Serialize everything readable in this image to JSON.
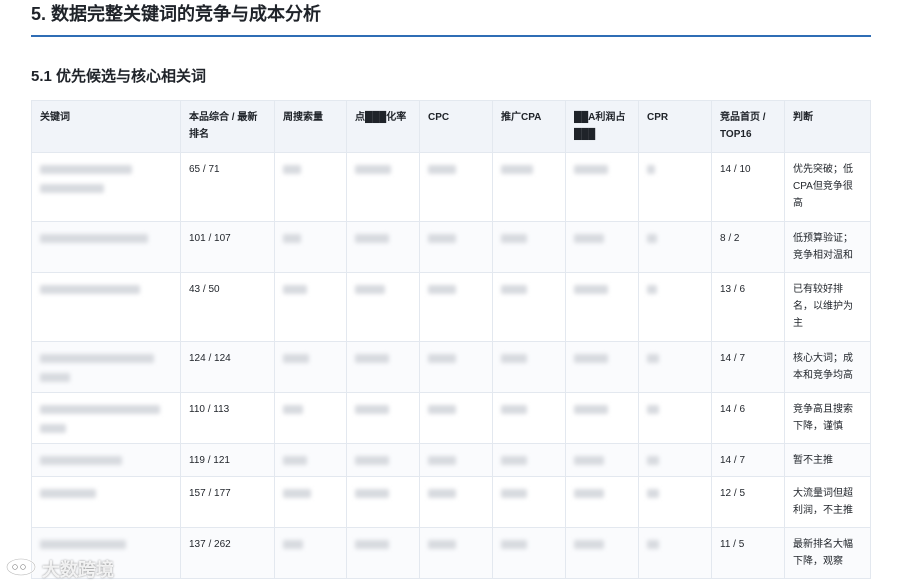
{
  "heading": "5. 数据完整关键词的竞争与成本分析",
  "subheading": "5.1 优先候选与核心相关词",
  "table": {
    "headers": [
      "关键词",
      "本品综合 / 最新排名",
      "周搜索量",
      "点███化率",
      "CPC",
      "推广CPA",
      "██A利润占███",
      "CPR",
      "竞品首页 / TOP16",
      "判断"
    ],
    "rows": [
      {
        "rank": "65 / 71",
        "top": "14 / 10",
        "judgement": "优先突破；低CPA但竞争很高"
      },
      {
        "rank": "101 / 107",
        "top": "8 / 2",
        "judgement": "低预算验证；竞争相对温和"
      },
      {
        "rank": "43 / 50",
        "top": "13 / 6",
        "judgement": "已有较好排名，以维护为主"
      },
      {
        "rank": "124 / 124",
        "top": "14 / 7",
        "judgement": "核心大词；成本和竞争均高"
      },
      {
        "rank": "110 / 113",
        "top": "14 / 6",
        "judgement": "竞争高且搜索下降，谨慎"
      },
      {
        "rank": "119 / 121",
        "top": "14 / 7",
        "judgement": "暂不主推"
      },
      {
        "rank": "157 / 177",
        "top": "12 / 5",
        "judgement": "大流量词但超利润，不主推"
      },
      {
        "rank": "137 / 262",
        "top": "11 / 5",
        "judgement": "最新排名大幅下降，观察"
      }
    ]
  },
  "watermark": {
    "text": "大数跨境",
    "icon": "brand-logo-icon"
  },
  "colors": {
    "rule": "#2f6db5",
    "header_bg": "#f1f4f9",
    "border": "#e3e8ef"
  }
}
